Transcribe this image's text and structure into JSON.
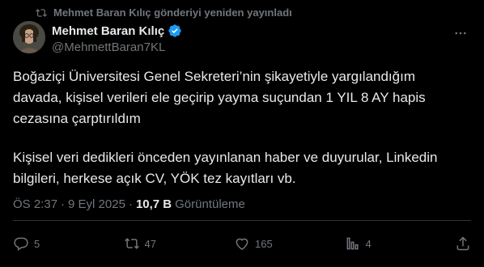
{
  "repost": {
    "text": "Mehmet Baran Kılıç gönderiyi yeniden yayınladı"
  },
  "author": {
    "name": "Mehmet Baran Kılıç",
    "handle": "@MehmettBaran7KL"
  },
  "tweet": {
    "paragraph1": "Boğaziçi Üniversitesi Genel Sekreteri’nin şikayetiyle yargılandığım davada, kişisel verileri ele geçirip yayma suçundan 1 YIL 8 AY hapis cezasına çarptırıldım",
    "paragraph2": "Kişisel veri dedikleri önceden yayınlanan haber ve duyurular, Linkedin bilgileri, herkese açık CV, YÖK tez kayıtları vb."
  },
  "meta": {
    "time": "ÖS 2:37",
    "separator": "·",
    "date": "9 Eyl 2025",
    "views_count": "10,7 B",
    "views_label": "Görüntüleme"
  },
  "actions": {
    "replies": "5",
    "reposts": "47",
    "likes": "165",
    "bookmarks": "4"
  },
  "colors": {
    "background": "#000000",
    "text": "#e7e9ea",
    "muted": "#71767b",
    "verified": "#1d9bf0"
  },
  "icons": [
    "repost-icon",
    "verified-badge-icon",
    "more-icon",
    "reply-icon",
    "retweet-icon",
    "like-icon",
    "bookmark-icon",
    "share-icon"
  ]
}
